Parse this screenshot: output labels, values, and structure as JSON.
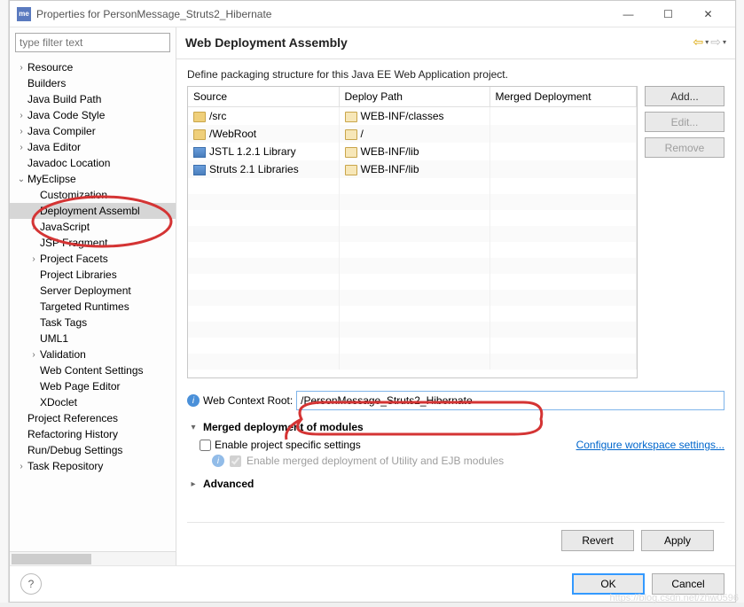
{
  "window": {
    "title": "Properties for PersonMessage_Struts2_Hibernate"
  },
  "filter": {
    "placeholder": "type filter text"
  },
  "tree": [
    {
      "label": "Resource",
      "level": 0,
      "exp": ">"
    },
    {
      "label": "Builders",
      "level": 0,
      "exp": ""
    },
    {
      "label": "Java Build Path",
      "level": 0,
      "exp": ""
    },
    {
      "label": "Java Code Style",
      "level": 0,
      "exp": ">"
    },
    {
      "label": "Java Compiler",
      "level": 0,
      "exp": ">"
    },
    {
      "label": "Java Editor",
      "level": 0,
      "exp": ">"
    },
    {
      "label": "Javadoc Location",
      "level": 0,
      "exp": ""
    },
    {
      "label": "MyEclipse",
      "level": 0,
      "exp": "v"
    },
    {
      "label": "Customization",
      "level": 1,
      "exp": ""
    },
    {
      "label": "Deployment Assembl",
      "level": 1,
      "exp": "",
      "selected": true
    },
    {
      "label": "JavaScript",
      "level": 1,
      "exp": ">"
    },
    {
      "label": "JSP Fragment",
      "level": 1,
      "exp": ""
    },
    {
      "label": "Project Facets",
      "level": 1,
      "exp": ">"
    },
    {
      "label": "Project Libraries",
      "level": 1,
      "exp": ""
    },
    {
      "label": "Server Deployment",
      "level": 1,
      "exp": ""
    },
    {
      "label": "Targeted Runtimes",
      "level": 1,
      "exp": ""
    },
    {
      "label": "Task Tags",
      "level": 1,
      "exp": ""
    },
    {
      "label": "UML1",
      "level": 1,
      "exp": ""
    },
    {
      "label": "Validation",
      "level": 1,
      "exp": ">"
    },
    {
      "label": "Web Content Settings",
      "level": 1,
      "exp": ""
    },
    {
      "label": "Web Page Editor",
      "level": 1,
      "exp": ""
    },
    {
      "label": "XDoclet",
      "level": 1,
      "exp": ""
    },
    {
      "label": "Project References",
      "level": 0,
      "exp": ""
    },
    {
      "label": "Refactoring History",
      "level": 0,
      "exp": ""
    },
    {
      "label": "Run/Debug Settings",
      "level": 0,
      "exp": ""
    },
    {
      "label": "Task Repository",
      "level": 0,
      "exp": ">"
    }
  ],
  "header": {
    "title": "Web Deployment Assembly"
  },
  "description": "Define packaging structure for this Java EE Web Application project.",
  "columns": {
    "source": "Source",
    "deploy": "Deploy Path",
    "merged": "Merged Deployment"
  },
  "rows": [
    {
      "src": "/src",
      "srcIcon": "folder-y",
      "dep": "WEB-INF/classes",
      "depIcon": "folder-o"
    },
    {
      "src": "/WebRoot",
      "srcIcon": "folder-y",
      "dep": "/",
      "depIcon": "folder-o"
    },
    {
      "src": "JSTL 1.2.1 Library",
      "srcIcon": "lib",
      "dep": "WEB-INF/lib",
      "depIcon": "folder-o"
    },
    {
      "src": "Struts 2.1 Libraries",
      "srcIcon": "lib",
      "dep": "WEB-INF/lib",
      "depIcon": "folder-o"
    }
  ],
  "buttons": {
    "add": "Add...",
    "edit": "Edit...",
    "remove": "Remove"
  },
  "context": {
    "label": "Web Context Root:",
    "value": "/PersonMessage_Struts2_Hibernate"
  },
  "merged": {
    "title": "Merged deployment of modules",
    "enable": "Enable project specific settings",
    "configure": "Configure workspace settings...",
    "sub": "Enable merged deployment of Utility and EJB modules"
  },
  "advanced": "Advanced",
  "footer": {
    "revert": "Revert",
    "apply": "Apply",
    "ok": "OK",
    "cancel": "Cancel"
  },
  "watermark": "https://blog.csdn.net/zhw0596"
}
